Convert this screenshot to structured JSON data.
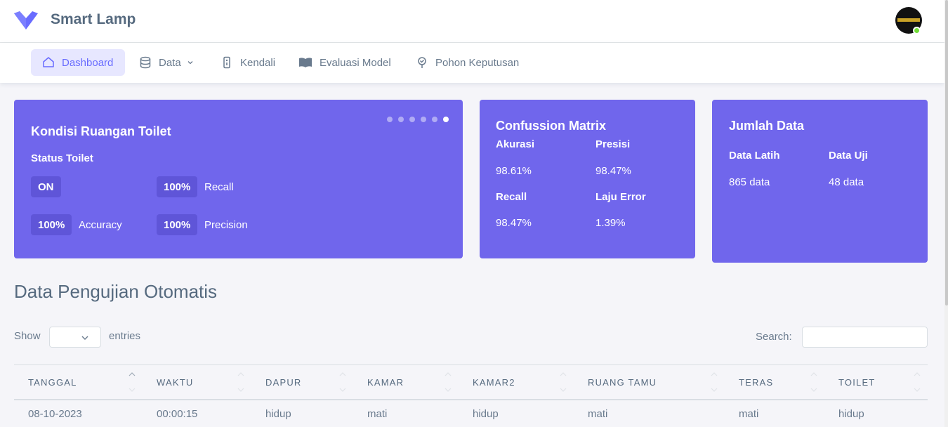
{
  "app": {
    "name": "Smart Lamp"
  },
  "nav": {
    "items": [
      {
        "label": "Dashboard",
        "icon": "home-icon",
        "active": true
      },
      {
        "label": "Data",
        "icon": "database-icon",
        "has_dropdown": true
      },
      {
        "label": "Kendali",
        "icon": "remote-icon"
      },
      {
        "label": "Evaluasi Model",
        "icon": "book-icon"
      },
      {
        "label": "Pohon Keputusan",
        "icon": "tree-icon"
      }
    ]
  },
  "kondisi": {
    "title": "Kondisi Ruangan Toilet",
    "status_label": "Status Toilet",
    "status_value": "ON",
    "accuracy_value": "100%",
    "accuracy_label": "Accuracy",
    "recall_value": "100%",
    "recall_label": "Recall",
    "precision_value": "100%",
    "precision_label": "Precision",
    "slides": 6,
    "active_slide": 6
  },
  "confusion": {
    "title": "Confussion Matrix",
    "akurasi_label": "Akurasi",
    "akurasi_value": "98.61%",
    "presisi_label": "Presisi",
    "presisi_value": "98.47%",
    "recall_label": "Recall",
    "recall_value": "98.47%",
    "error_label": "Laju Error",
    "error_value": "1.39%"
  },
  "jumlah": {
    "title": "Jumlah Data",
    "latih_label": "Data Latih",
    "latih_value": "865 data",
    "uji_label": "Data Uji",
    "uji_value": "48 data"
  },
  "section": {
    "title": "Data Pengujian Otomatis",
    "show_label": "Show",
    "entries_label": "entries",
    "search_label": "Search:",
    "search_value": ""
  },
  "table": {
    "columns": [
      "TANGGAL",
      "WAKTU",
      "DAPUR",
      "KAMAR",
      "KAMAR2",
      "RUANG TAMU",
      "TERAS",
      "TOILET"
    ],
    "rows": [
      [
        "08-10-2023",
        "00:00:15",
        "hidup",
        "mati",
        "hidup",
        "mati",
        "mati",
        "hidup"
      ]
    ]
  },
  "colors": {
    "accent": "#696cff",
    "card_bg": "#7066ec",
    "online": "#71dd37"
  }
}
